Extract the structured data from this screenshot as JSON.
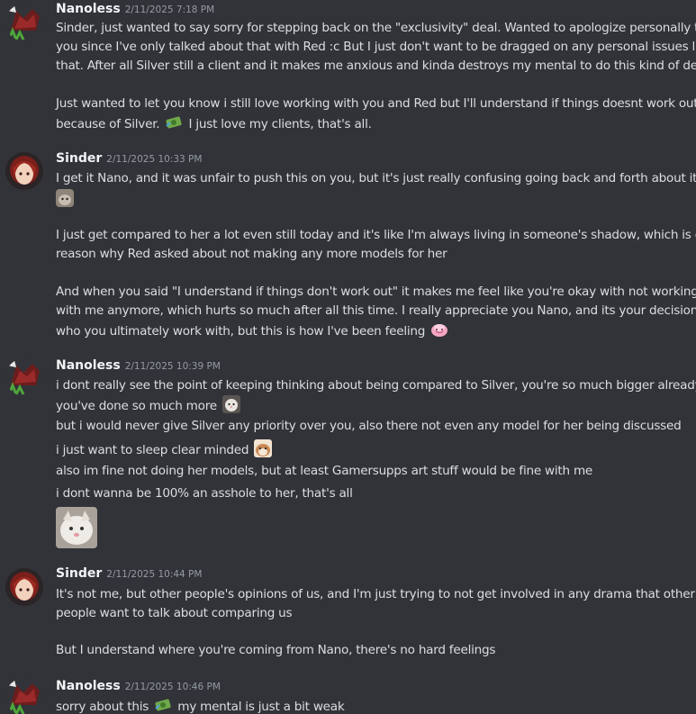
{
  "messages": [
    {
      "author": "Nanoless",
      "timestamp": "2/11/2025 7:18 PM",
      "avatar_icon": "dragon-avatar-icon",
      "lines": [
        "Sinder, just wanted to say sorry for stepping back on the \"exclusivity\" deal. Wanted to apologize personally to",
        "you since I've only talked about that with Red :c But I just don't want to be dragged on any personal issues like",
        "that. After all Silver still a client and it makes me anxious and kinda destroys my mental to do this kind of deal.",
        "Just wanted to let you know i still love working with you and Red but I'll understand if things doesnt work out",
        "because of Silver.",
        "I just love my clients, that's all."
      ]
    },
    {
      "author": "Sinder",
      "timestamp": "2/11/2025 10:33 PM",
      "avatar_icon": "redhead-avatar-icon",
      "lines": [
        "I get it Nano, and it was unfair to push this on you, but it's just really confusing going back and forth about it",
        "I just get compared to her a lot even still today and it's like I'm always living in someone's shadow, which is one",
        "reason why Red asked about not making any more models for her",
        "And when you said \"I understand if things don't work out\" it makes me feel like you're okay with not working",
        "with me anymore, which hurts so much after all this time. I really appreciate you Nano, and its your decision",
        "who you ultimately work with, but this is how I've been feeling"
      ]
    },
    {
      "author": "Nanoless",
      "timestamp": "2/11/2025 10:39 PM",
      "avatar_icon": "dragon-avatar-icon",
      "lines": [
        "i dont really see the point of keeping thinking about being compared to Silver, you're so much bigger already,",
        "you've done so much more",
        "but i would never give Silver any priority over you, also there not even any model for her being discussed",
        "i just want to sleep clear minded",
        "also im fine not doing her models, but at least Gamersupps art stuff would be fine with me",
        "i dont wanna be 100% an asshole to her, that's all"
      ]
    },
    {
      "author": "Sinder",
      "timestamp": "2/11/2025 10:44 PM",
      "avatar_icon": "redhead-avatar-icon",
      "lines": [
        "It's not me, but other people's opinions of us, and I'm just trying to not get involved in any drama that other",
        "people want to talk about comparing us",
        "But I understand where you're coming from Nano, there's no hard feelings"
      ]
    },
    {
      "author": "Nanoless",
      "timestamp": "2/11/2025 10:46 PM",
      "avatar_icon": "dragon-avatar-icon",
      "lines": [
        "sorry about this",
        "my mental is just a bit weak"
      ]
    }
  ],
  "emoji_icons": [
    "money-emoji-icon",
    "cat-emoji-icon",
    "blush-emoji-icon",
    "cat-face-emoji-icon",
    "hamster-emoji-icon",
    "cat-sticker-image"
  ],
  "colors": {
    "background": "#313338",
    "text": "#dbdee1",
    "name": "#f2f3f5",
    "timestamp": "#949ba4"
  }
}
